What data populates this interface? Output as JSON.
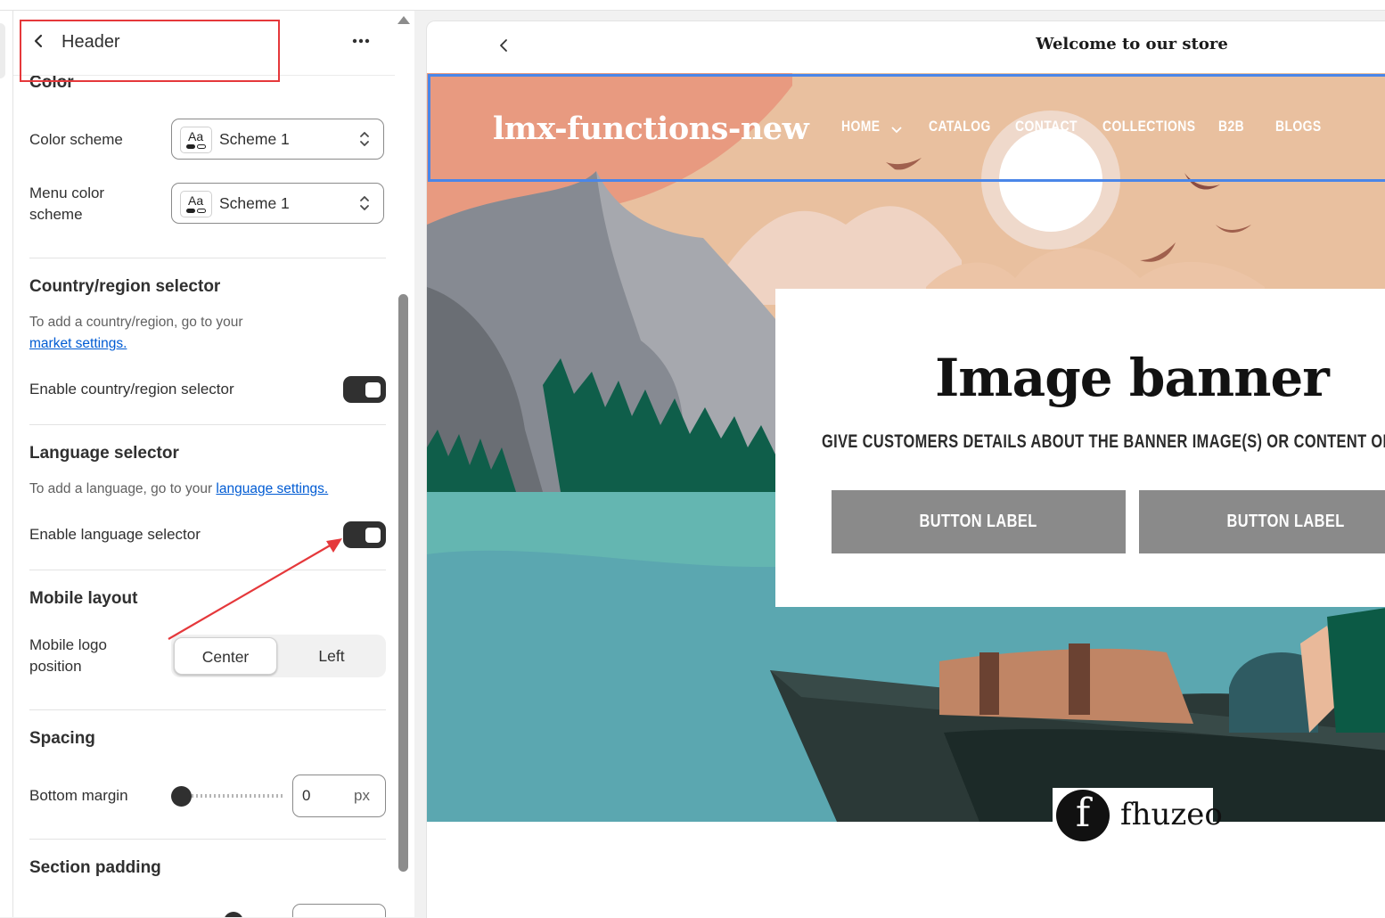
{
  "panel": {
    "title": "Header",
    "partial_heading": "Color",
    "color_scheme_label": "Color scheme",
    "color_scheme_value": "Scheme 1",
    "menu_color_scheme_label_line1": "Menu color",
    "menu_color_scheme_label_line2": "scheme",
    "menu_color_scheme_value": "Scheme 1",
    "swatch_glyph": "Aa",
    "country_heading": "Country/region selector",
    "country_help_line1": "To add a country/region, go to your",
    "country_help_link": "market settings.",
    "country_toggle_label": "Enable country/region selector",
    "country_toggle_on": true,
    "language_heading": "Language selector",
    "language_help": "To add a language, go to your",
    "language_help_link": "language settings.",
    "language_toggle_label": "Enable language selector",
    "language_toggle_on": true,
    "mobile_heading": "Mobile layout",
    "mobile_logo_label_line1": "Mobile logo",
    "mobile_logo_label_line2": "position",
    "mobile_logo_options": [
      "Center",
      "Left"
    ],
    "mobile_logo_selected": "Center",
    "spacing_heading": "Spacing",
    "bottom_margin_label": "Bottom margin",
    "bottom_margin_value": "0",
    "bottom_margin_unit": "px",
    "section_padding_heading": "Section padding"
  },
  "preview": {
    "announcement": "Welcome to our store",
    "logo": "lmx-functions-new",
    "nav": [
      "HOME",
      "CATALOG",
      "CONTACT",
      "COLLECTIONS",
      "B2B",
      "BLOGS"
    ],
    "banner_title": "Image banner",
    "banner_subtitle": "GIVE CUSTOMERS DETAILS ABOUT THE BANNER IMAGE(S) OR CONTENT ON THE TEMPLATE.",
    "button_1": "BUTTON LABEL",
    "button_2": "BUTTON LABEL",
    "watermark": "fhuzeo",
    "watermark_glyph": "f"
  },
  "colors": {
    "highlight_red": "#e5383b",
    "selection_blue": "#4a86e8",
    "toggle_dark": "#303030",
    "link_blue": "#005bd3",
    "sky_peach": "#e8c0a0",
    "water_teal": "#5aa7b0"
  }
}
